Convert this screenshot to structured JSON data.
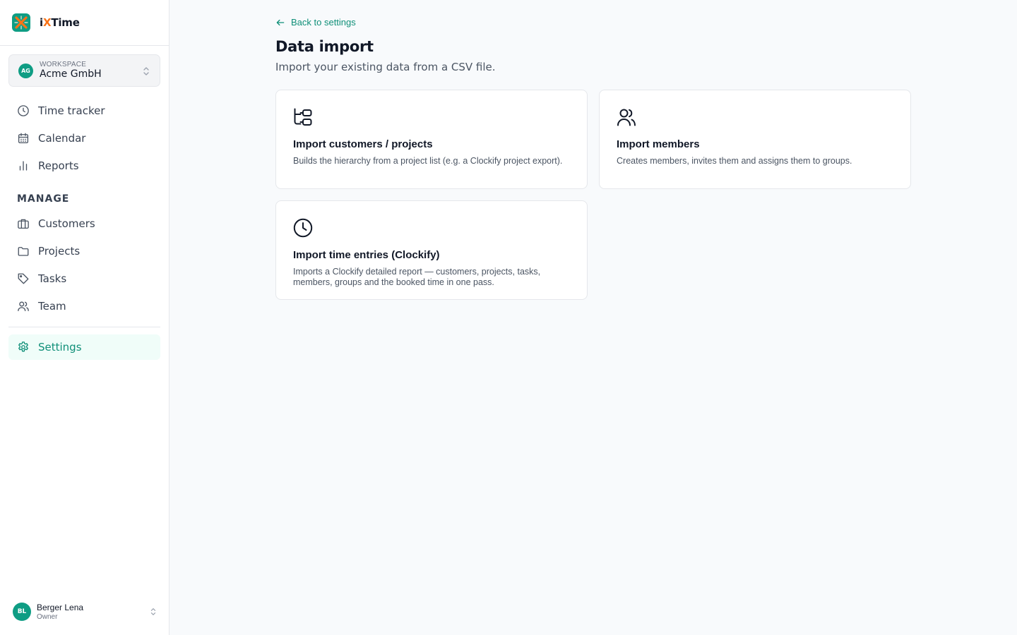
{
  "brand": {
    "name_prefix": "i",
    "name_x": "X",
    "name_suffix": "Time",
    "icon": "brand-logo-icon",
    "accent": "#0f9d84",
    "accent_x": "#f97316"
  },
  "workspace": {
    "avatar": "AG",
    "label": "WORKSPACE",
    "name": "Acme GmbH"
  },
  "nav": {
    "main": [
      {
        "label": "Time tracker",
        "icon": "clock-icon"
      },
      {
        "label": "Calendar",
        "icon": "calendar-icon"
      },
      {
        "label": "Reports",
        "icon": "bar-chart-icon"
      }
    ],
    "section_title": "MANAGE",
    "manage": [
      {
        "label": "Customers",
        "icon": "briefcase-icon"
      },
      {
        "label": "Projects",
        "icon": "folder-icon"
      },
      {
        "label": "Tasks",
        "icon": "tag-icon"
      },
      {
        "label": "Team",
        "icon": "users-icon"
      }
    ],
    "settings": {
      "label": "Settings",
      "icon": "gear-icon",
      "active": true
    }
  },
  "user": {
    "avatar": "BL",
    "name": "Berger Lena",
    "role": "Owner"
  },
  "page": {
    "back_label": "Back to settings",
    "title": "Data import",
    "subtitle": "Import your existing data from a CSV file."
  },
  "cards": [
    {
      "title": "Import customers / projects",
      "description": "Builds the hierarchy from a project list (e.g. a Clockify project export).",
      "icon": "hierarchy-icon"
    },
    {
      "title": "Import members",
      "description": "Creates members, invites them and assigns them to groups.",
      "icon": "users-icon"
    },
    {
      "title": "Import time entries (Clockify)",
      "description": "Imports a Clockify detailed report — customers, projects, tasks, members, groups and the booked time in one pass.",
      "icon": "clock-icon"
    }
  ],
  "colors": {
    "primary": "#0f8f78",
    "background": "#f8fafc",
    "active_bg": "#f0fdf9"
  }
}
